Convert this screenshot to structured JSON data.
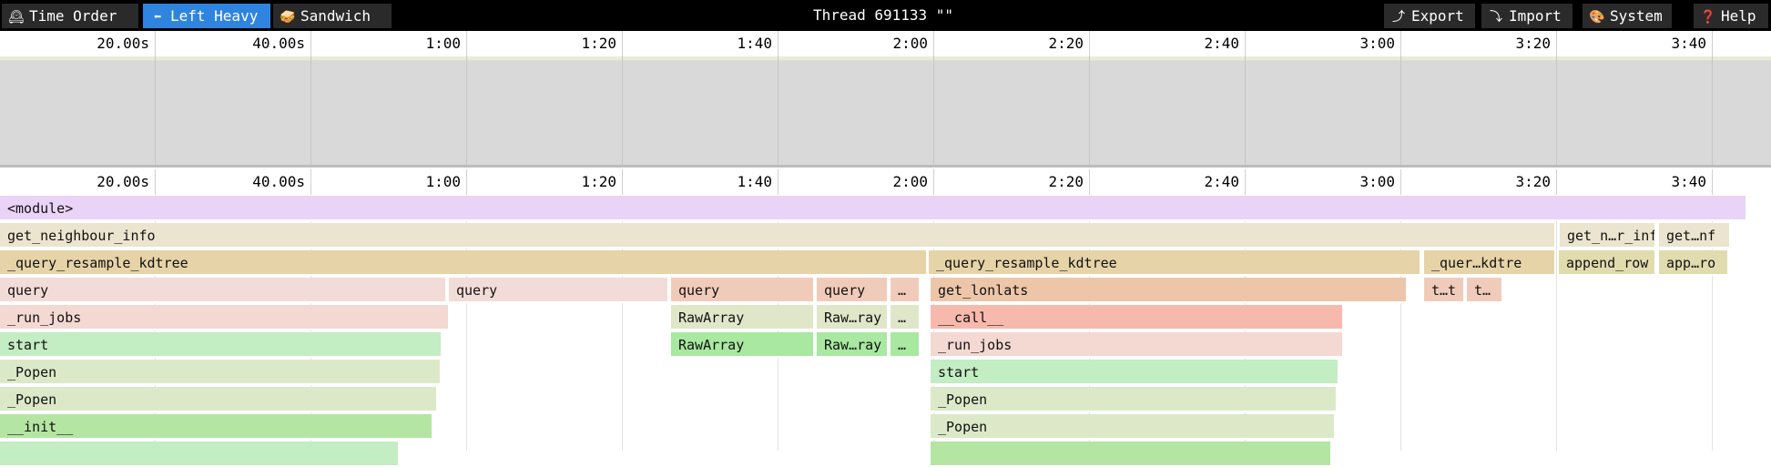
{
  "toolbar": {
    "views": [
      {
        "icon": "🕰",
        "icon_name": "clock-icon",
        "label": "Time Order",
        "active": false
      },
      {
        "icon": "⬅",
        "icon_name": "left-arrow-icon",
        "label": "Left Heavy",
        "active": true
      },
      {
        "icon": "🥪",
        "icon_name": "sandwich-icon",
        "label": "Sandwich",
        "active": false
      }
    ],
    "title": "Thread 691133 \"\"",
    "actions": [
      {
        "icon": "⤴",
        "icon_name": "export-icon",
        "label": "Export"
      },
      {
        "icon": "⤵",
        "icon_name": "import-icon",
        "label": "Import"
      },
      {
        "icon": "🎨",
        "icon_name": "palette-icon",
        "label": "System"
      },
      {
        "icon": "❓",
        "icon_name": "help-icon",
        "label": "Help"
      }
    ]
  },
  "ruler": {
    "labels": [
      "20.00s",
      "40.00s",
      "1:00",
      "1:20",
      "1:40",
      "2:00",
      "2:20",
      "2:40",
      "3:00",
      "3:20",
      "3:40"
    ]
  },
  "colors": {
    "accent": "#2f84e0",
    "toolbar_bg": "#000000",
    "minimap_bg": "#d9d9d9"
  },
  "flame": {
    "rows": [
      [
        {
          "name": "<module>",
          "color": "#e9d3f6",
          "span": 95
        }
      ],
      [
        {
          "name": "get_neighbour_info",
          "color": "#ebe5cf",
          "span": 85
        },
        {
          "name": "get_n…r_inf",
          "color": "#ebe5cf",
          "span": 5.5
        },
        {
          "name": "get…nf",
          "color": "#ebe5cf",
          "span": 4
        }
      ],
      [
        {
          "name": "_query_resample_kdtree",
          "color": "#e6d4a8",
          "span": 50
        },
        {
          "name": "_query_resample_kdtree",
          "color": "#e6d4a8",
          "span": 25.8
        },
        {
          "name": "_quer…kdtre",
          "color": "#e6d4a8",
          "span": 5.5
        },
        {
          "name": "append_row",
          "color": "#e1dcae",
          "span": 5.5
        },
        {
          "name": "app…ro",
          "color": "#e1dcae",
          "span": 4
        }
      ],
      [
        {
          "name": "query",
          "color": "#f2dcd8",
          "span": 24
        },
        {
          "name": "query",
          "color": "#f2dcd8",
          "span": 12
        },
        {
          "name": "query",
          "color": "#f1cbb9",
          "span": 7.8
        },
        {
          "name": "query",
          "color": "#f1cbb9",
          "span": 4
        },
        {
          "name": "…",
          "color": "#f1cbb9",
          "span": 1.5
        },
        {
          "name": "get_lonlats",
          "color": "#edc6a9",
          "span": 25
        },
        {
          "name": "t…t",
          "color": "#f1cbb9",
          "span": 2.3
        },
        {
          "name": "t…",
          "color": "#f1cbb9",
          "span": 2
        }
      ],
      [
        {
          "name": "_run_jobs",
          "color": "#f4d8d2",
          "span": 24
        },
        {
          "name": "RawArray",
          "color": "#e0e7c9",
          "span": 7.8
        },
        {
          "name": "Raw…ray",
          "color": "#e0e7c9",
          "span": 4
        },
        {
          "name": "…",
          "color": "#e0e7c9",
          "span": 1.5
        },
        {
          "name": "__call__",
          "color": "#f8b9ad",
          "span": 22
        }
      ],
      [
        {
          "name": "start",
          "color": "#c3edc2",
          "span": 24
        },
        {
          "name": "RawArray",
          "color": "#a8e8a0",
          "span": 7.8
        },
        {
          "name": "Raw…ray",
          "color": "#a8e8a0",
          "span": 4
        },
        {
          "name": "…",
          "color": "#a8e8a0",
          "span": 1.5
        },
        {
          "name": "_run_jobs",
          "color": "#f4d8d2",
          "span": 22
        }
      ],
      [
        {
          "name": "_Popen",
          "color": "#dce9c8",
          "span": 24
        },
        {
          "name": "start",
          "color": "#c3edc2",
          "span": 22
        }
      ],
      [
        {
          "name": "_Popen",
          "color": "#dce9c8",
          "span": 24
        },
        {
          "name": "_Popen",
          "color": "#dce9c8",
          "span": 22
        }
      ],
      [
        {
          "name": "__init__",
          "color": "#b5e5a3",
          "span": 24
        },
        {
          "name": "_Popen",
          "color": "#dce9c8",
          "span": 22
        }
      ],
      [
        {
          "name": "",
          "color": "#c3edc2",
          "span": 22
        },
        {
          "name": "",
          "color": "#b5e5a3",
          "span": 22
        }
      ]
    ]
  }
}
